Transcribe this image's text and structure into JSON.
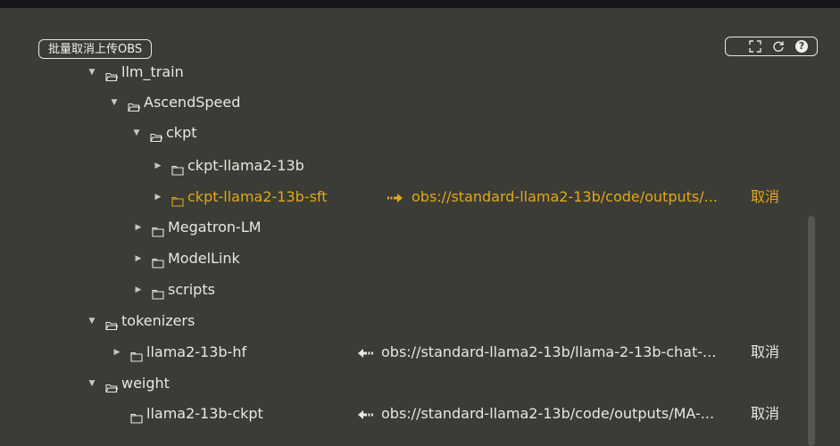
{
  "toolbar": {
    "batch_cancel_label": "批量取消上传OBS",
    "icons": [
      "fullscreen-icon",
      "refresh-icon",
      "help-icon"
    ],
    "help_glyph": "?"
  },
  "colors": {
    "background": "#3c3c36",
    "text": "#e8e8e2",
    "highlight": "#e0a81b"
  },
  "tree": [
    {
      "label": "llm_train",
      "expanded": true,
      "icon": "folder-open-icon"
    },
    {
      "label": "AscendSpeed",
      "expanded": true,
      "icon": "folder-open-icon"
    },
    {
      "label": "ckpt",
      "expanded": true,
      "icon": "folder-open-icon"
    },
    {
      "label": "ckpt-llama2-13b",
      "expanded": false,
      "icon": "folder-icon"
    },
    {
      "label": "ckpt-llama2-13b-sft",
      "expanded": false,
      "icon": "folder-icon",
      "highlighted": true,
      "direction": "upload",
      "mapping": "obs://standard-llama2-13b/code/outputs/...",
      "cancel": "取消"
    },
    {
      "label": "Megatron-LM",
      "expanded": false,
      "icon": "folder-icon"
    },
    {
      "label": "ModelLink",
      "expanded": false,
      "icon": "folder-icon"
    },
    {
      "label": "scripts",
      "expanded": false,
      "icon": "folder-icon"
    },
    {
      "label": "tokenizers",
      "expanded": true,
      "icon": "folder-open-icon"
    },
    {
      "label": "llama2-13b-hf",
      "expanded": false,
      "icon": "folder-icon",
      "direction": "download",
      "mapping": "obs://standard-llama2-13b/llama-2-13b-chat-...",
      "cancel": "取消"
    },
    {
      "label": "weight",
      "expanded": true,
      "icon": "folder-open-icon"
    },
    {
      "label": "llama2-13b-ckpt",
      "icon": "folder-icon",
      "direction": "download",
      "mapping": "obs://standard-llama2-13b/code/outputs/MA-...",
      "cancel": "取消"
    }
  ]
}
